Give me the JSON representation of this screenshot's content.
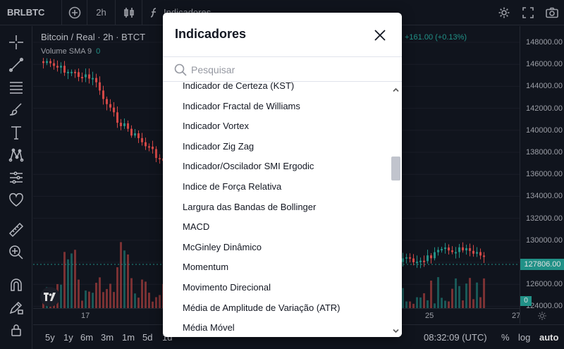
{
  "topbar": {
    "symbol": "BRLBTC",
    "interval": "2h",
    "indicators_label": "Indicadores",
    "add_icon": "plus-circle-icon",
    "candle_icon": "candles-icon",
    "fx_icon": "fx-icon",
    "settings_icon": "gear-icon",
    "fullscreen_icon": "fullscreen-icon",
    "camera_icon": "camera-icon"
  },
  "left_tools": [
    "crosshair-icon",
    "trendline-icon",
    "fib-icon",
    "brush-icon",
    "text-icon",
    "pattern-icon",
    "forecast-icon",
    "heart-icon",
    "ruler-icon",
    "zoom-in-icon",
    "magnet-icon",
    "lock-draw-icon",
    "lock-icon"
  ],
  "chart": {
    "legend": "Bitcoin / Real · 2h · BTCT",
    "volume_label": "Volume SMA 9",
    "volume_value": "0",
    "change": "+161.00 (+0.13%)",
    "colors": {
      "up": "#26a69a",
      "down": "#ef5350",
      "background": "#131722"
    }
  },
  "price_axis": {
    "labels": [
      "148000.00",
      "146000.00",
      "144000.00",
      "142000.00",
      "140000.00",
      "138000.00",
      "136000.00",
      "134000.00",
      "132000.00",
      "130000.00",
      "128000.00",
      "126000.00",
      "124000.00"
    ],
    "last_price": "127806.00",
    "volume_last": "0"
  },
  "time_axis": {
    "labels": [
      "17",
      "25",
      "27"
    ]
  },
  "bottom": {
    "ranges": [
      "5y",
      "1y",
      "6m",
      "3m",
      "1m",
      "5d",
      "1d"
    ],
    "clock": "08:32:09 (UTC)",
    "percent": "%",
    "log": "log",
    "auto": "auto"
  },
  "modal": {
    "title": "Indicadores",
    "search_placeholder": "Pesquisar",
    "items": [
      "Indicador de Certeza (KST)",
      "Indicador Fractal de Williams",
      "Indicador Vortex",
      "Indicador Zig Zag",
      "Indicador/Oscilador SMI Ergodic",
      "Indice de Força Relativa",
      "Largura das Bandas de Bollinger",
      "MACD",
      "McGinley Dinâmico",
      "Momentum",
      "Movimento Direcional",
      "Média de Amplitude de Variação (ATR)",
      "Média Móvel"
    ]
  }
}
